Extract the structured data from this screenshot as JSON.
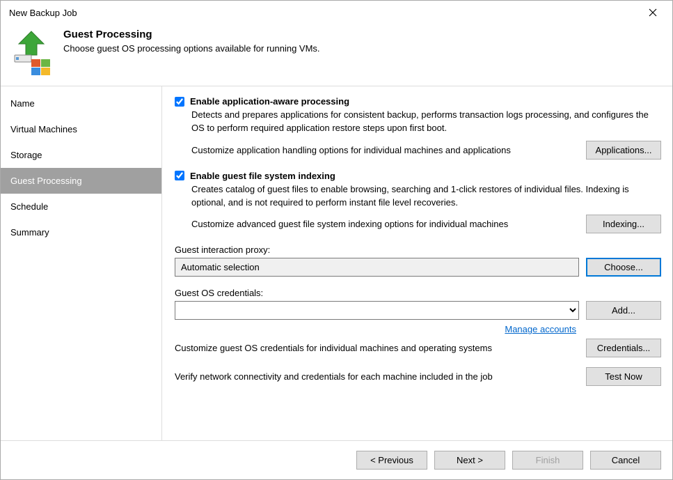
{
  "window": {
    "title": "New Backup Job",
    "close": "✕"
  },
  "header": {
    "title": "Guest Processing",
    "subtitle": "Choose guest OS processing options available for running VMs."
  },
  "sidebar": {
    "items": [
      {
        "label": "Name"
      },
      {
        "label": "Virtual Machines"
      },
      {
        "label": "Storage"
      },
      {
        "label": "Guest Processing"
      },
      {
        "label": "Schedule"
      },
      {
        "label": "Summary"
      }
    ]
  },
  "main": {
    "appaware": {
      "label": "Enable application-aware processing",
      "desc": "Detects and prepares applications for consistent backup, performs transaction logs processing, and configures the OS to perform required application restore steps upon first boot.",
      "customize_text": "Customize application handling options for individual machines and applications",
      "button": "Applications..."
    },
    "indexing": {
      "label": "Enable guest file system indexing",
      "desc": "Creates catalog of guest files to enable browsing, searching and 1-click restores of individual files. Indexing is optional, and is not required to perform instant file level recoveries.",
      "customize_text": "Customize advanced guest file system indexing options for individual machines",
      "button": "Indexing..."
    },
    "proxy": {
      "label": "Guest interaction proxy:",
      "value": "Automatic selection",
      "button": "Choose..."
    },
    "credentials": {
      "label": "Guest OS credentials:",
      "value": "",
      "button": "Add...",
      "manage_link": "Manage accounts",
      "customize_text": "Customize guest OS credentials for individual machines and operating systems",
      "customize_button": "Credentials..."
    },
    "verify": {
      "text": "Verify network connectivity and credentials for each machine included in the job",
      "button": "Test Now"
    }
  },
  "footer": {
    "previous": "< Previous",
    "next": "Next >",
    "finish": "Finish",
    "cancel": "Cancel"
  }
}
